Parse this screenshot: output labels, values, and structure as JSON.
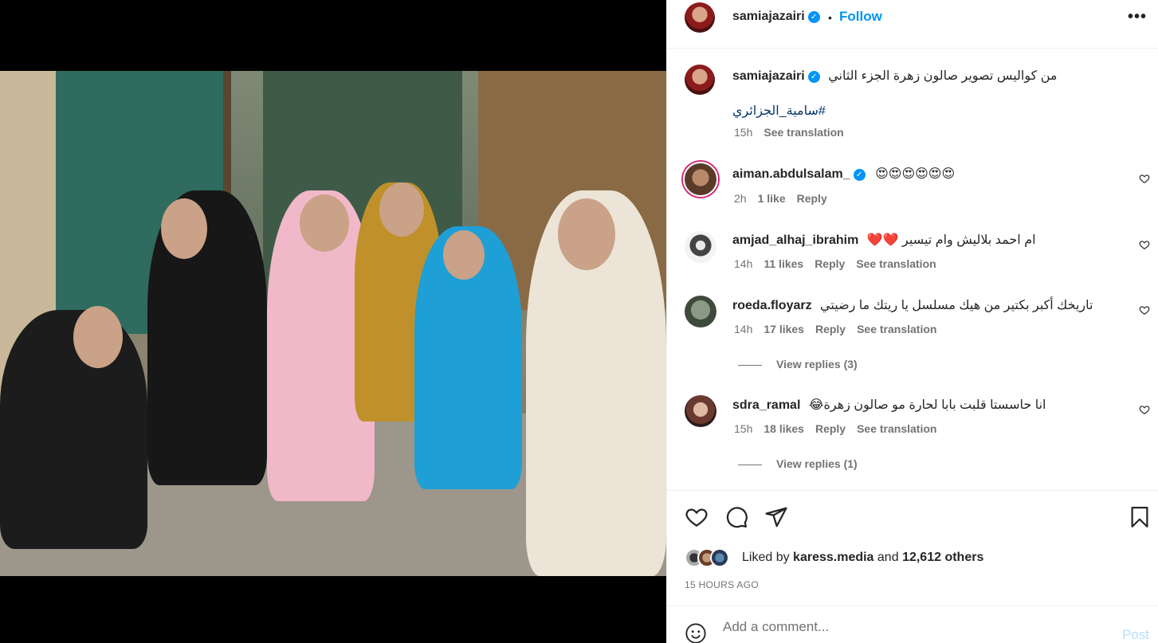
{
  "post": {
    "author": "samiajazairi",
    "follow_label": "Follow",
    "dot": "•",
    "more": "•••"
  },
  "caption": {
    "username": "samiajazairi",
    "text": "من كواليس تصوير صالون زهرة الجزء الثاني",
    "hashtag": "#سامية_الجزائري",
    "time": "15h",
    "see_translation": "See translation"
  },
  "comments": [
    {
      "username": "aiman.abdulsalam_",
      "verified": true,
      "text": "😍😍😍😍😍😍",
      "time": "2h",
      "likes": "1 like",
      "reply": "Reply",
      "see_translation": ""
    },
    {
      "username": "amjad_alhaj_ibrahim",
      "verified": false,
      "text": "ام احمد بلاليش وام تيسير ❤️❤️",
      "time": "14h",
      "likes": "11 likes",
      "reply": "Reply",
      "see_translation": "See translation"
    },
    {
      "username": "roeda.floyarz",
      "verified": false,
      "text": "تاريخك أكبر بكتير من هيك مسلسل يا ريتك ما رضيتي",
      "time": "14h",
      "likes": "17 likes",
      "reply": "Reply",
      "see_translation": "See translation",
      "view_replies": "View replies (3)"
    },
    {
      "username": "sdra_ramal",
      "verified": false,
      "text": "انا حاسستا قلبت بابا لحارة مو صالون زهرة😂",
      "time": "15h",
      "likes": "18 likes",
      "reply": "Reply",
      "see_translation": "See translation",
      "view_replies": "View replies (1)"
    }
  ],
  "likes": {
    "liked_by": "Liked by",
    "first_liker": "karess.media",
    "and": "and",
    "others": "12,612 others"
  },
  "timestamp": "15 HOURS AGO",
  "add_comment": {
    "placeholder": "Add a comment...",
    "post_label": "Post"
  },
  "colors": {
    "link_blue": "#0095f6",
    "text": "#262626",
    "secondary": "#737373",
    "post_disabled": "#b2dffc"
  }
}
